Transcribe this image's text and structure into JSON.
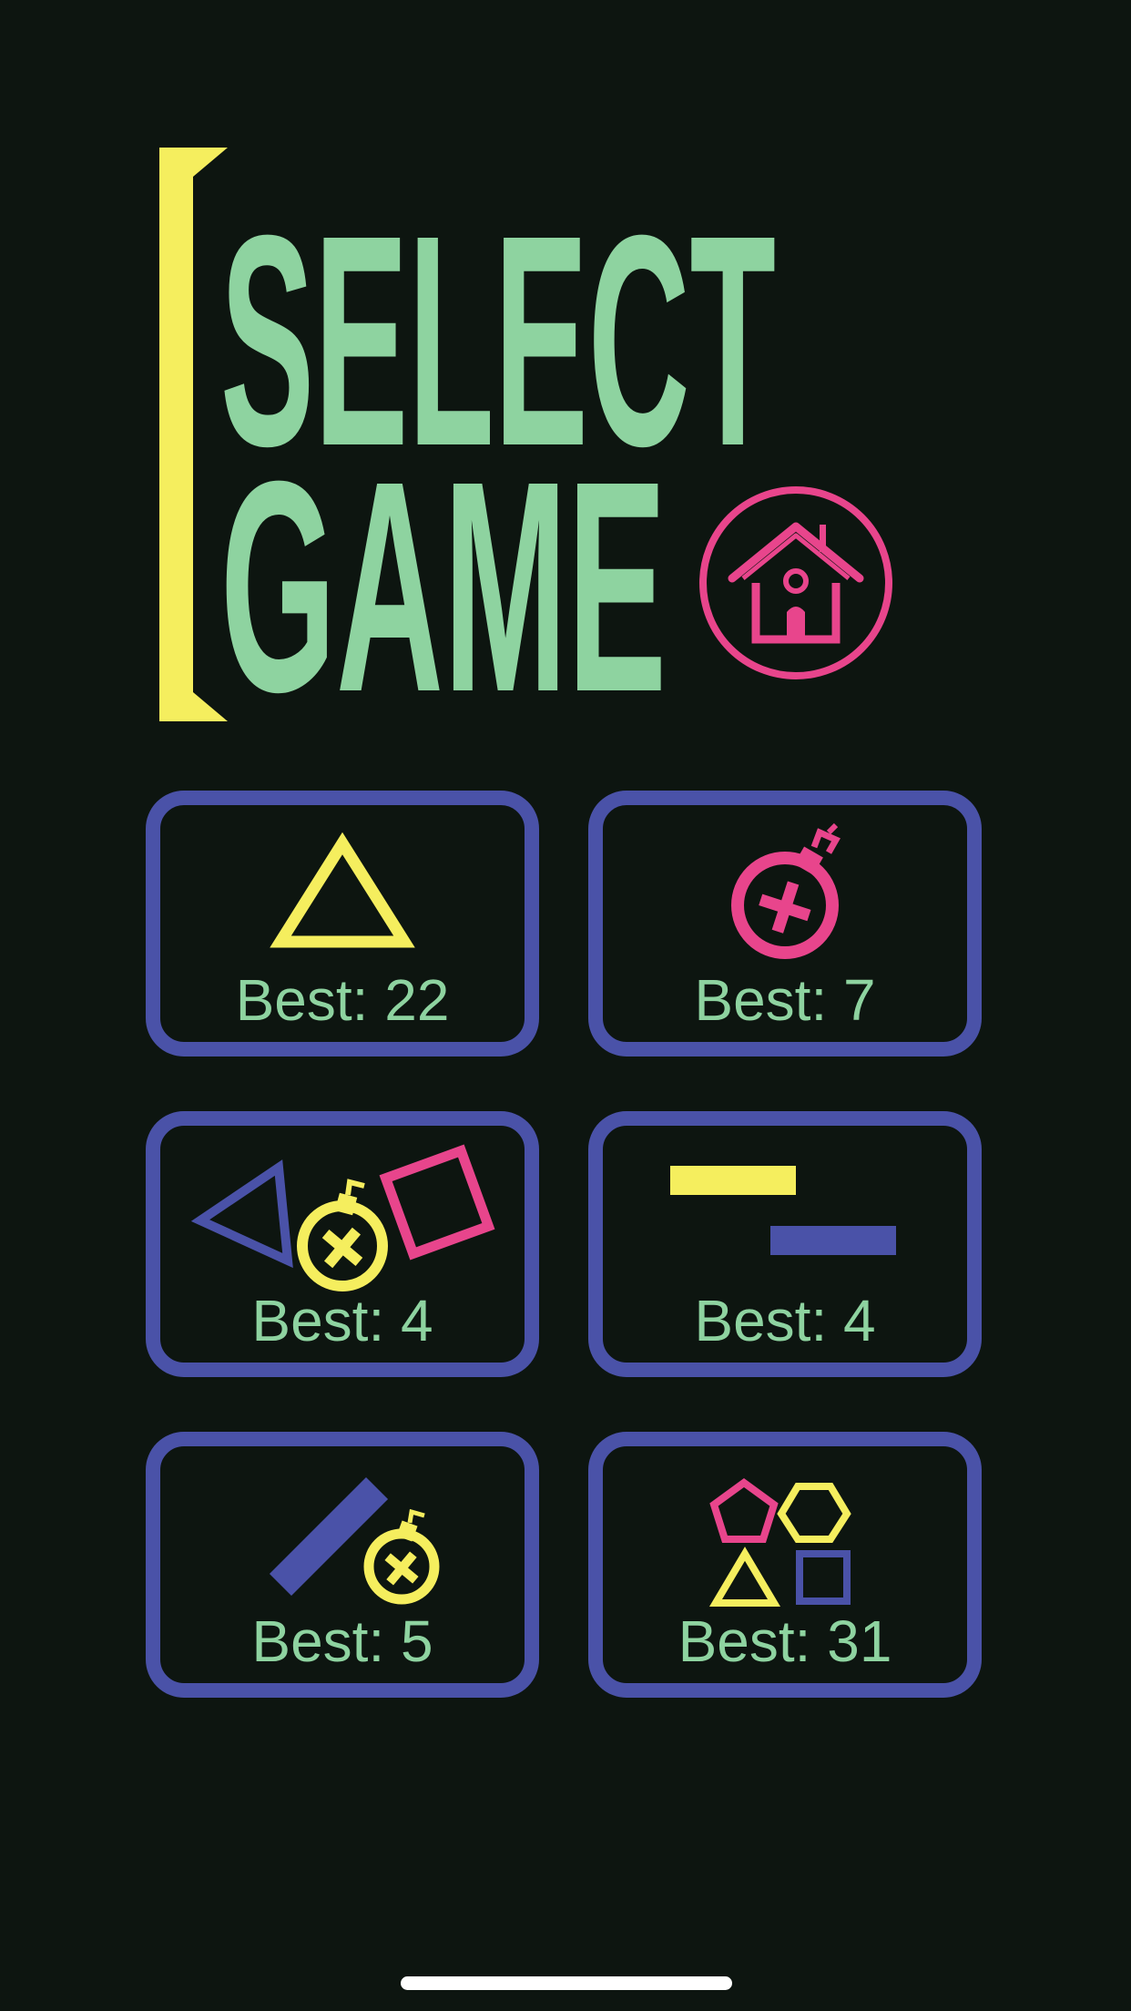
{
  "title": {
    "line1": "SELECT",
    "line2": "GAME"
  },
  "home_button": {
    "icon": "home-icon"
  },
  "colors": {
    "background": "#0d1510",
    "title_green": "#8ed3a0",
    "accent_yellow": "#f5ee5e",
    "accent_pink": "#e8458c",
    "card_border": "#4a52a8",
    "score_text": "#8ed3a0"
  },
  "games": [
    {
      "icon": "triangle-icon",
      "best_label": "Best: 22"
    },
    {
      "icon": "bomb-icon",
      "best_label": "Best: 7"
    },
    {
      "icon": "shapes-and-bomb-icon",
      "best_label": "Best: 4"
    },
    {
      "icon": "sliding-bars-icon",
      "best_label": "Best: 4"
    },
    {
      "icon": "diagonal-bar-and-bomb-icon",
      "best_label": "Best: 5"
    },
    {
      "icon": "four-shapes-icon",
      "best_label": "Best: 31"
    }
  ]
}
